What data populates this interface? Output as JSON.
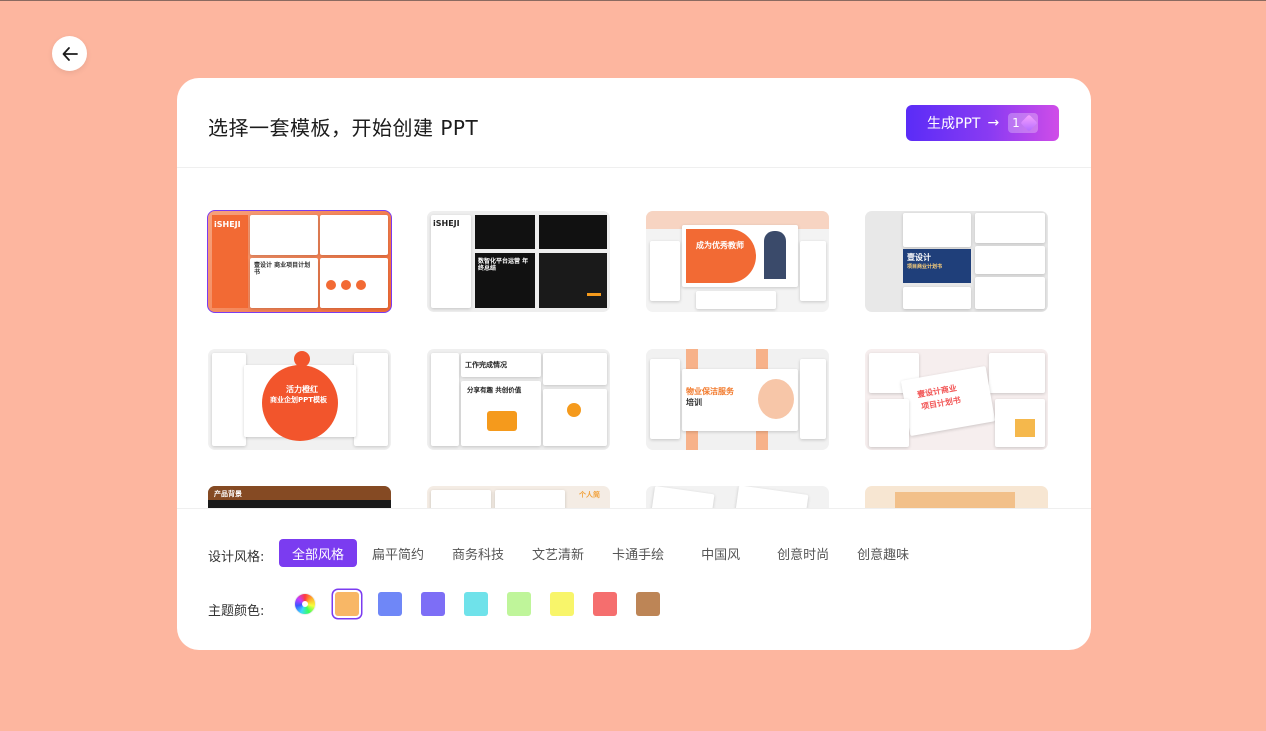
{
  "header": {
    "title": "选择一套模板，开始创建 PPT",
    "generate_label": "生成PPT",
    "generate_arrow": "→",
    "credit_count": "1"
  },
  "templates": [
    {
      "id": "t1",
      "mini_title": "iSHEJI",
      "sub": "壹设计 商业项目计划书",
      "accent": "#f26a34",
      "selected": true
    },
    {
      "id": "t2",
      "mini_title": "iSHEJI",
      "sub": "数智化平台运营 年终总结",
      "accent": "#f59a1c",
      "selected": false
    },
    {
      "id": "t3",
      "mini_title": "成为优秀教师",
      "sub": "",
      "accent": "#f26a34",
      "selected": false
    },
    {
      "id": "t4",
      "mini_title": "壹设计",
      "sub": "项目商业计划书",
      "accent": "#1f3f7a",
      "selected": false
    },
    {
      "id": "t5",
      "mini_title": "活力橙红",
      "sub": "商业企划PPT模板",
      "accent": "#f2552c",
      "selected": false
    },
    {
      "id": "t6",
      "mini_title": "工作完成情况",
      "sub": "分享有趣 共创价值",
      "accent": "#f59a1c",
      "selected": false
    },
    {
      "id": "t7",
      "mini_title": "物业保洁服务",
      "sub": "培训",
      "accent": "#f27a2c",
      "selected": false
    },
    {
      "id": "t8",
      "mini_title": "壹设计商业",
      "sub": "项目计划书",
      "accent": "#f25555",
      "selected": false
    },
    {
      "id": "t9",
      "mini_title": "产品背景",
      "sub": "",
      "accent": "#f07a2c",
      "selected": false
    },
    {
      "id": "t10",
      "mini_title": "个人简",
      "sub": "",
      "accent": "#f2a23c",
      "selected": false
    },
    {
      "id": "t11",
      "mini_title": "",
      "sub": "",
      "accent": "#f27a2c",
      "selected": false
    },
    {
      "id": "t12",
      "mini_title": "",
      "sub": "",
      "accent": "#f2a23c",
      "selected": false
    }
  ],
  "filters": {
    "style_label": "设计风格:",
    "color_label": "主题颜色:",
    "styles": [
      "全部风格",
      "扁平简约",
      "商务科技",
      "文艺清新",
      "卡通手绘",
      "中国风",
      "创意时尚",
      "创意趣味"
    ],
    "active_style": 0,
    "colors": [
      "#f8b766",
      "#6f87f7",
      "#7d6ef6",
      "#6fe2ea",
      "#bff59a",
      "#f8f56a",
      "#f56e6e",
      "#bd8556"
    ],
    "active_color": 0
  }
}
